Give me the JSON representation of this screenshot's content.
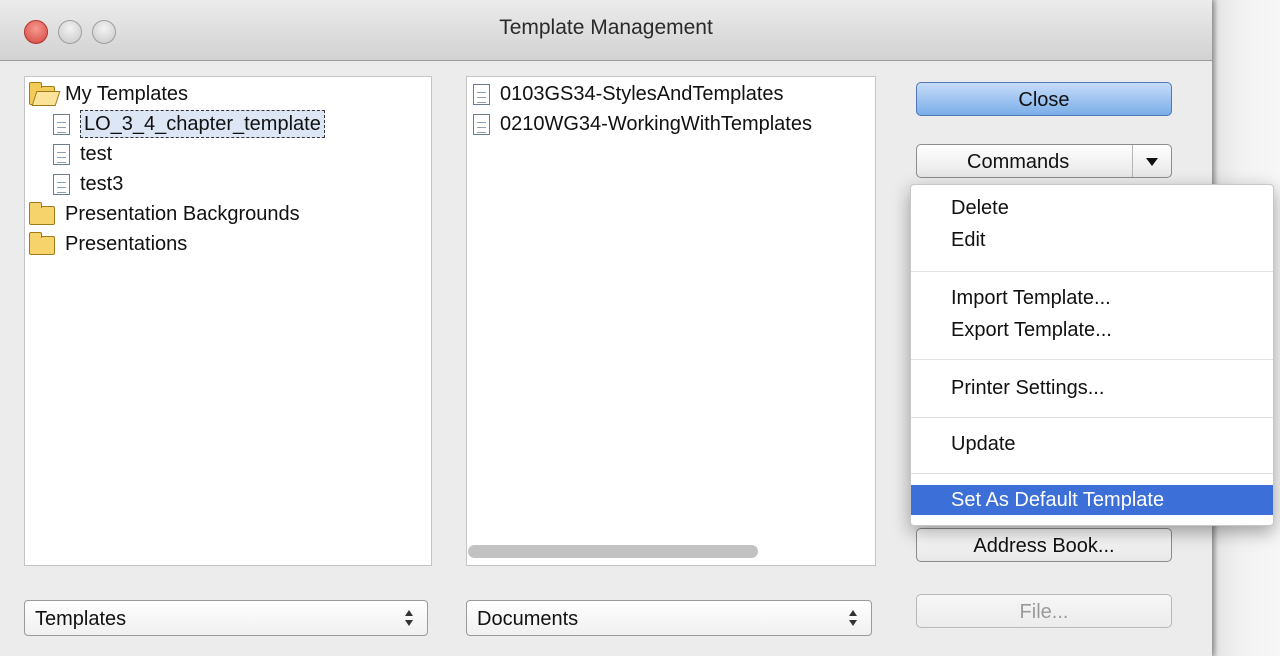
{
  "window": {
    "title": "Template Management"
  },
  "categories": {
    "items": [
      {
        "label": "My Templates",
        "type": "folder-open",
        "expanded": true
      },
      {
        "label": "LO_3_4_chapter_template",
        "type": "document",
        "selected": true
      },
      {
        "label": "test",
        "type": "document"
      },
      {
        "label": "test3",
        "type": "document"
      },
      {
        "label": "Presentation Backgrounds",
        "type": "folder"
      },
      {
        "label": "Presentations",
        "type": "folder"
      }
    ]
  },
  "documents": {
    "items": [
      {
        "label": "0103GS34-StylesAndTemplates",
        "type": "document"
      },
      {
        "label": "0210WG34-WorkingWithTemplates",
        "type": "document"
      }
    ]
  },
  "buttons": {
    "close": "Close",
    "commands": "Commands",
    "address_book": "Address Book...",
    "file": "File..."
  },
  "selects": {
    "left": "Templates",
    "right": "Documents"
  },
  "commands_menu": {
    "items": [
      {
        "label": "Delete"
      },
      {
        "label": "Edit"
      },
      {
        "label": "Import Template..."
      },
      {
        "label": "Export Template..."
      },
      {
        "label": "Printer Settings..."
      },
      {
        "label": "Update"
      },
      {
        "label": "Set As Default Template",
        "highlighted": true
      }
    ]
  },
  "colors": {
    "menu_highlight": "#3d6fd9",
    "default_button": "#7aaee8"
  }
}
